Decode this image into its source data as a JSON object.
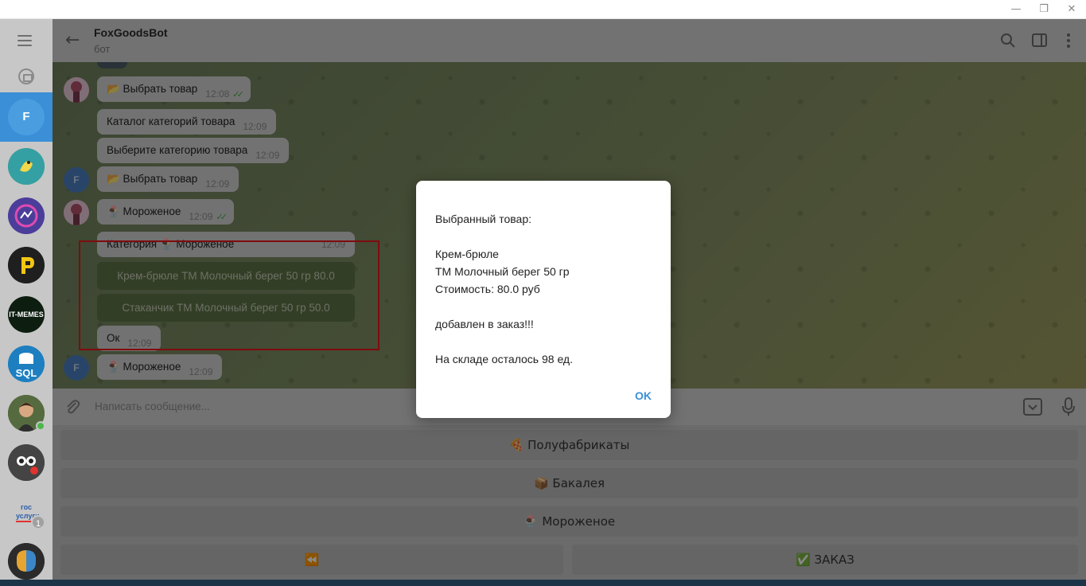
{
  "window": {
    "minimize": "—",
    "restore": "❐",
    "close": "✕"
  },
  "sidebar": {
    "active_chat_initial": "F",
    "chats": [
      {
        "name": "python-chat",
        "color": "#2e8b57"
      },
      {
        "name": "chat-purple",
        "color": "#5a46a8"
      },
      {
        "name": "chat-p",
        "color": "#222222"
      },
      {
        "name": "chat-it-memes",
        "label": "IT-MEMES",
        "color": "#1a2a1a"
      },
      {
        "name": "chat-sql",
        "label": "SQL",
        "color": "#1d7fc0"
      },
      {
        "name": "chat-person",
        "color": "#4a5b3a"
      },
      {
        "name": "chat-robot",
        "color": "#3a3a3a"
      },
      {
        "name": "chat-gosuslugi",
        "label": "гос услуги",
        "badge": "1",
        "color": "#ffffff"
      },
      {
        "name": "chat-brain",
        "color": "#2b2b2b"
      }
    ]
  },
  "header": {
    "title": "FoxGoodsBot",
    "subtitle": "бот"
  },
  "messages": [
    {
      "id": "m1",
      "text": "📂 Выбрать товар",
      "time": "12:08",
      "ticks": "✓✓"
    },
    {
      "id": "m2",
      "text": "Каталог категорий товара",
      "time": "12:09"
    },
    {
      "id": "m3",
      "text": "Выберите категорию товара",
      "time": "12:09"
    },
    {
      "id": "m4",
      "avatar": "F",
      "text": "📂 Выбрать товар",
      "time": "12:09"
    },
    {
      "id": "m5",
      "text": "🍨 Мороженое",
      "time": "12:09",
      "ticks": "✓✓"
    },
    {
      "id": "m6",
      "text": "Категория 🍨 Мороженое",
      "time": "12:09"
    },
    {
      "id": "m7",
      "text": "Ок",
      "time": "12:09"
    },
    {
      "id": "m8",
      "avatar": "F",
      "text": "🍨 Мороженое",
      "time": "12:09"
    }
  ],
  "inline_buttons": [
    "Крем-брюле ТМ Молочный берег 50 гр 80.0",
    "Стаканчик ТМ Молочный берег 50 гр 50.0"
  ],
  "dialog": {
    "line1": "Выбранный товар:",
    "line2": "Крем-брюле",
    "line3": "ТМ Молочный берег 50 гр",
    "line4": "Стоимость: 80.0 руб",
    "line5": "добавлен в заказ!!!",
    "line6": "На складе осталось 98 ед.",
    "ok": "OK"
  },
  "input": {
    "placeholder": "Написать сообщение..."
  },
  "keyboard": {
    "row1": "🍕 Полуфабрикаты",
    "row2": "📦 Бакалея",
    "row3": "🍨 Мороженое",
    "back": "⏪",
    "order": "✅ ЗАКАЗ"
  },
  "colors": {
    "accent": "#3a8fd6",
    "highlight_box": "#e8171b",
    "inline_button": "#5e7246"
  }
}
